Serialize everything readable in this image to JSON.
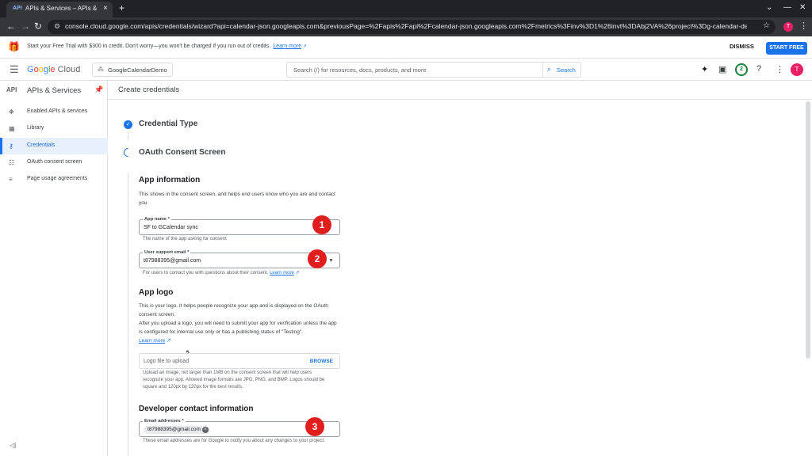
{
  "browser": {
    "tab_favicon": "API",
    "tab_title": "APIs & Services – APIs & Services",
    "tab_close": "×",
    "new_tab": "+",
    "url": "console.cloud.google.com/apis/credentials/wizard?api=calendar-json.googleapis.com&previousPage=%2Fapis%2Fapi%2Fcalendar-json.googleapis.com%2Fmetrics%3Finv%3D1%26invt%3DAbj2VA%26project%3Dg-calendar-demo-test78511&in...",
    "profile_initial": "T"
  },
  "banner": {
    "text": "Start your Free Trial with $300 in credit. Don't worry—you won't be charged if you run out of credits.",
    "link": "Learn more",
    "dismiss": "DISMISS",
    "start_free": "START FREE"
  },
  "header": {
    "logo_google": [
      "G",
      "o",
      "o",
      "g",
      "l",
      "e"
    ],
    "logo_cloud": "Cloud",
    "project": "GoogleCalendarDemo",
    "search_placeholder": "Search (/) for resources, docs, products, and more",
    "search_button": "Search",
    "notification_count": "2",
    "avatar_initial": "T"
  },
  "sidebar": {
    "icon_text": "API",
    "title": "APIs & Services",
    "items": [
      {
        "label": "Enabled APIs & services",
        "icon": "enabled-apis-icon"
      },
      {
        "label": "Library",
        "icon": "library-icon"
      },
      {
        "label": "Credentials",
        "icon": "key-icon"
      },
      {
        "label": "OAuth consent screen",
        "icon": "consent-icon"
      },
      {
        "label": "Page usage agreements",
        "icon": "agreements-icon"
      }
    ],
    "active_index": 2
  },
  "main": {
    "page_title": "Create credentials",
    "steps": [
      {
        "label": "Credential Type",
        "status": "complete"
      },
      {
        "label": "OAuth Consent Screen",
        "status": "in-progress"
      }
    ],
    "app_info": {
      "title": "App information",
      "description": "This shows in the consent screen, and helps end users know who you are and contact you",
      "app_name_label": "App name *",
      "app_name_value": "SF to GCalendar sync",
      "app_name_helper": "The name of the app asking for consent",
      "support_email_label": "User support email *",
      "support_email_value": "t87988395@gmail.com",
      "support_email_helper": "For users to contact you with questions about their consent.",
      "support_email_link": "Learn more"
    },
    "app_logo": {
      "title": "App logo",
      "description_1": "This is your logo. It helps people recognize your app and is displayed on the OAuth consent screen.",
      "description_2": "After you upload a logo, you will need to submit your app for verification unless the app is configured for internal use only or has a publishing status of \"Testing\".",
      "link": "Learn more",
      "field_placeholder": "Logo file to upload",
      "browse": "BROWSE",
      "helper": "Upload an image, not larger than 1MB on the consent screen that will help users recognize your app. Allowed image formats are JPG, PNG, and BMP. Logos should be square and 120px by 120px for the best results."
    },
    "developer": {
      "title": "Developer contact information",
      "email_label": "Email addresses *",
      "email_chip": "t87988395@gmail.com",
      "helper": "These email addresses are for Google to notify you about any changes to your project."
    },
    "badges": [
      "1",
      "2",
      "3"
    ]
  }
}
